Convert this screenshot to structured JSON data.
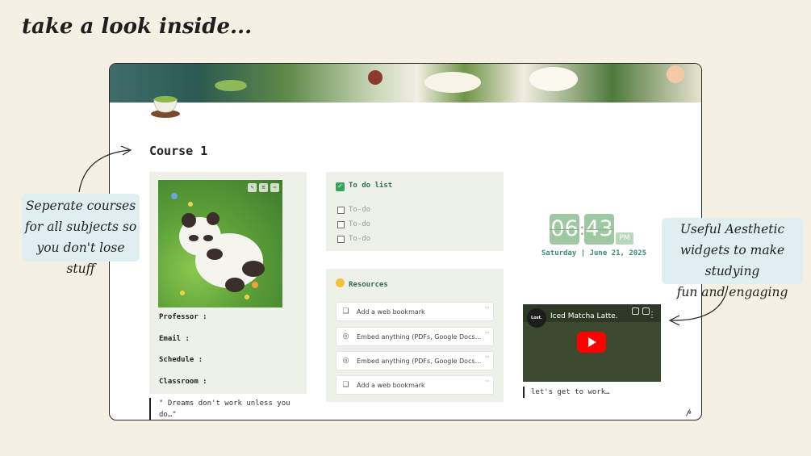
{
  "headline": "take a look inside...",
  "page": {
    "title": "Course 1",
    "icon": "matcha-cup-icon"
  },
  "course_info": {
    "professor_label": "Professor :",
    "email_label": "Email :",
    "schedule_label": "Schedule :",
    "classroom_label": "Classroom :"
  },
  "quote": "\" Dreams don't work unless you do…\"",
  "todo": {
    "heading": "To do list",
    "items": [
      "To-do",
      "To-do",
      "To-do"
    ]
  },
  "resources": {
    "heading": "Resources",
    "items": [
      {
        "label": "Add a web bookmark",
        "icon": "bookmark-icon"
      },
      {
        "label": "Embed anything (PDFs, Google Docs...",
        "icon": "compass-icon"
      },
      {
        "label": "Embed anything (PDFs, Google Docs...",
        "icon": "compass-icon"
      },
      {
        "label": "Add a web bookmark",
        "icon": "bookmark-icon"
      }
    ]
  },
  "clock": {
    "hour": "06",
    "minute": "43",
    "ampm": "PM",
    "date": "Saturday | June 21, 2025"
  },
  "video": {
    "channel": "Lost.",
    "title": "Iced Matcha Latte."
  },
  "caption": "let's get to work…",
  "callouts": {
    "left": [
      "Seperate courses",
      "for all subjects so",
      "you don't lose stuff"
    ],
    "right": [
      "Useful Aesthetic",
      "widgets to make studying",
      "fun and engaging"
    ]
  },
  "colors": {
    "background": "#f4f1e4",
    "accent_green": "#3b8a7a",
    "clock_green": "#9fc7a1",
    "callout_bg": "#dfeef0"
  }
}
